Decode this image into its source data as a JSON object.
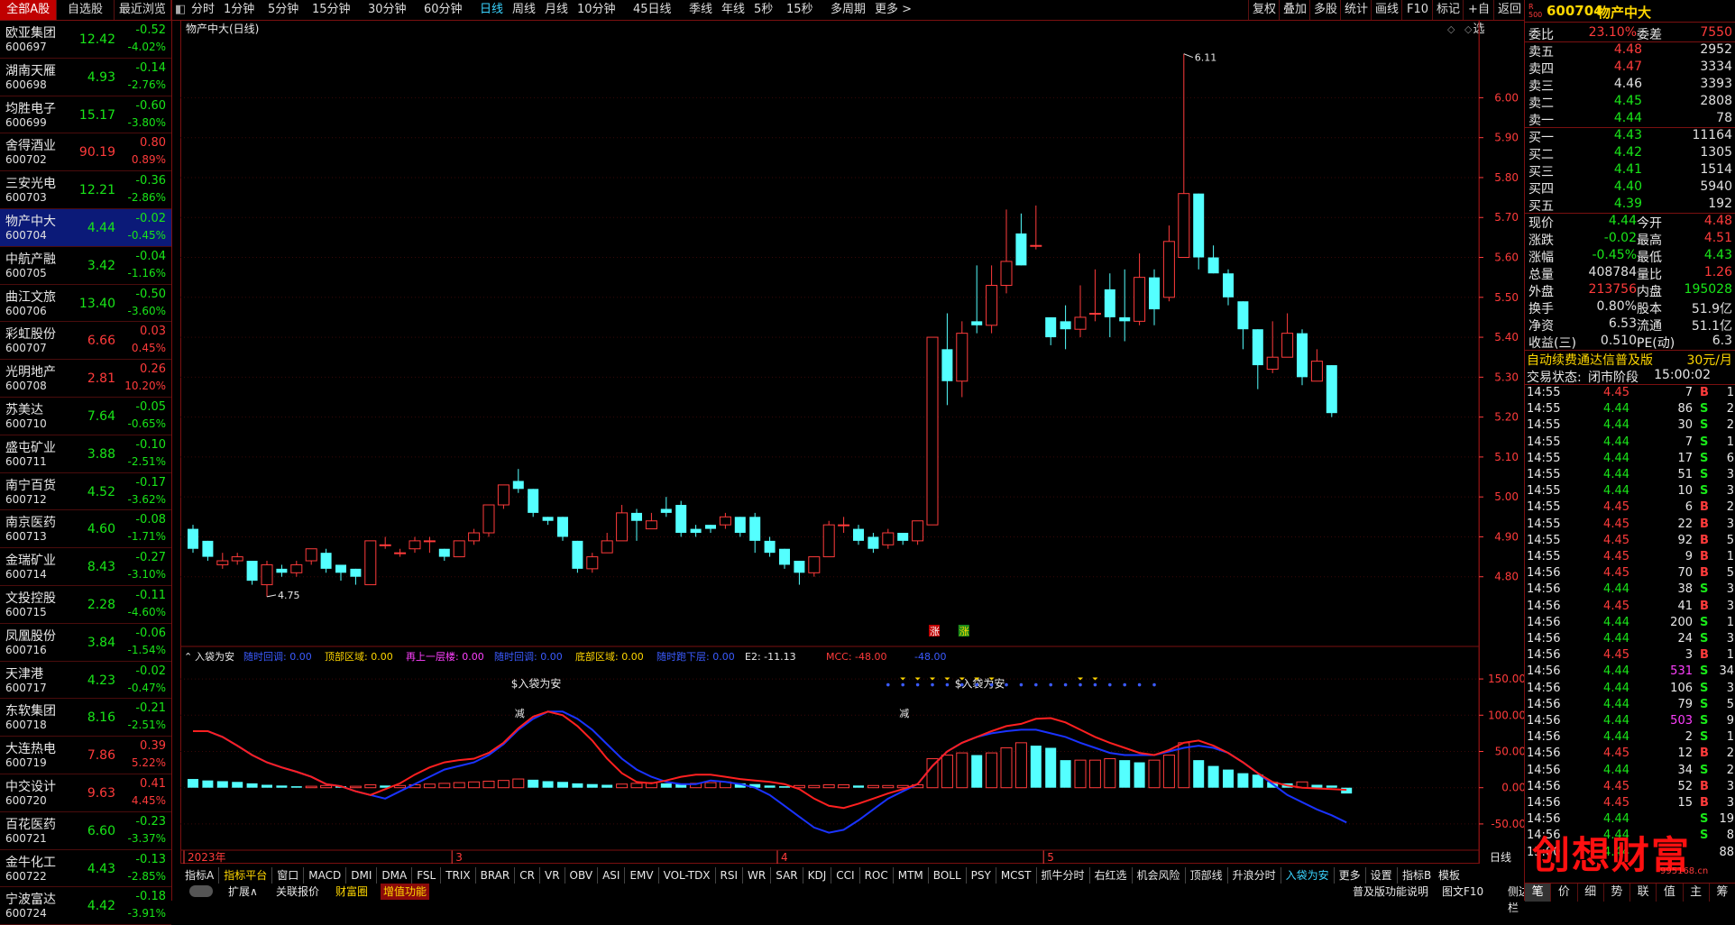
{
  "left_tabs": [
    "全部A股",
    "自选股",
    "最近浏览"
  ],
  "stocks": [
    {
      "name": "欧亚集团",
      "code": "600697",
      "price": "12.42",
      "chg": "-0.52",
      "pct": "-4.02%",
      "dir": "dn"
    },
    {
      "name": "湖南天雁",
      "code": "600698",
      "price": "4.93",
      "chg": "-0.14",
      "pct": "-2.76%",
      "dir": "dn"
    },
    {
      "name": "均胜电子",
      "code": "600699",
      "price": "15.17",
      "chg": "-0.60",
      "pct": "-3.80%",
      "dir": "dn"
    },
    {
      "name": "舍得酒业",
      "code": "600702",
      "price": "90.19",
      "chg": "0.80",
      "pct": "0.89%",
      "dir": "up"
    },
    {
      "name": "三安光电",
      "code": "600703",
      "price": "12.21",
      "chg": "-0.36",
      "pct": "-2.86%",
      "dir": "dn"
    },
    {
      "name": "物产中大",
      "code": "600704",
      "price": "4.44",
      "chg": "-0.02",
      "pct": "-0.45%",
      "dir": "dn",
      "selected": true
    },
    {
      "name": "中航产融",
      "code": "600705",
      "price": "3.42",
      "chg": "-0.04",
      "pct": "-1.16%",
      "dir": "dn"
    },
    {
      "name": "曲江文旅",
      "code": "600706",
      "price": "13.40",
      "chg": "-0.50",
      "pct": "-3.60%",
      "dir": "dn"
    },
    {
      "name": "彩虹股份",
      "code": "600707",
      "price": "6.66",
      "chg": "0.03",
      "pct": "0.45%",
      "dir": "up"
    },
    {
      "name": "光明地产",
      "code": "600708",
      "price": "2.81",
      "chg": "0.26",
      "pct": "10.20%",
      "dir": "up"
    },
    {
      "name": "苏美达",
      "code": "600710",
      "price": "7.64",
      "chg": "-0.05",
      "pct": "-0.65%",
      "dir": "dn"
    },
    {
      "name": "盛屯矿业",
      "code": "600711",
      "price": "3.88",
      "chg": "-0.10",
      "pct": "-2.51%",
      "dir": "dn"
    },
    {
      "name": "南宁百货",
      "code": "600712",
      "price": "4.52",
      "chg": "-0.17",
      "pct": "-3.62%",
      "dir": "dn"
    },
    {
      "name": "南京医药",
      "code": "600713",
      "price": "4.60",
      "chg": "-0.08",
      "pct": "-1.71%",
      "dir": "dn"
    },
    {
      "name": "金瑞矿业",
      "code": "600714",
      "price": "8.43",
      "chg": "-0.27",
      "pct": "-3.10%",
      "dir": "dn"
    },
    {
      "name": "文投控股",
      "code": "600715",
      "price": "2.28",
      "chg": "-0.11",
      "pct": "-4.60%",
      "dir": "dn"
    },
    {
      "name": "凤凰股份",
      "code": "600716",
      "price": "3.84",
      "chg": "-0.06",
      "pct": "-1.54%",
      "dir": "dn"
    },
    {
      "name": "天津港",
      "code": "600717",
      "price": "4.23",
      "chg": "-0.02",
      "pct": "-0.47%",
      "dir": "dn"
    },
    {
      "name": "东软集团",
      "code": "600718",
      "price": "8.16",
      "chg": "-0.21",
      "pct": "-2.51%",
      "dir": "dn"
    },
    {
      "name": "大连热电",
      "code": "600719",
      "price": "7.86",
      "chg": "0.39",
      "pct": "5.22%",
      "dir": "up"
    },
    {
      "name": "中交设计",
      "code": "600720",
      "price": "9.63",
      "chg": "0.41",
      "pct": "4.45%",
      "dir": "up"
    },
    {
      "name": "百花医药",
      "code": "600721",
      "price": "6.60",
      "chg": "-0.23",
      "pct": "-3.37%",
      "dir": "dn"
    },
    {
      "name": "金牛化工",
      "code": "600722",
      "price": "4.43",
      "chg": "-0.13",
      "pct": "-2.85%",
      "dir": "dn"
    },
    {
      "name": "宁波富达",
      "code": "600724",
      "price": "4.42",
      "chg": "-0.18",
      "pct": "-3.91%",
      "dir": "dn"
    }
  ],
  "toolbar": {
    "periods": [
      "分时",
      "1分钟",
      "5分钟",
      "15分钟",
      "30分钟",
      "60分钟",
      "日线",
      "周线",
      "月线",
      "10分钟",
      "45日线",
      "季线",
      "年线",
      "5秒",
      "15秒",
      "多周期",
      "更多 >"
    ],
    "active_period": "日线",
    "right_buttons": [
      "复权",
      "叠加",
      "多股",
      "统计",
      "画线",
      "F10",
      "标记",
      "+自选",
      "返回"
    ]
  },
  "chart_title": "物产中大(日线)",
  "chart_data": {
    "type": "candlestick",
    "y_ticks": [
      "6.00",
      "5.90",
      "5.80",
      "5.70",
      "5.60",
      "5.50",
      "5.40",
      "5.30",
      "5.20",
      "5.10",
      "5.00",
      "4.90",
      "4.80"
    ],
    "ylim": [
      4.75,
      6.11
    ],
    "high_label": "6.11",
    "low_label": "4.75",
    "x_labels": [
      "2023年",
      "3",
      "4",
      "5"
    ],
    "candles": [
      [
        4.92,
        4.87,
        4.93,
        4.86
      ],
      [
        4.89,
        4.85,
        4.89,
        4.84
      ],
      [
        4.83,
        4.84,
        4.86,
        4.82
      ],
      [
        4.84,
        4.85,
        4.86,
        4.83
      ],
      [
        4.84,
        4.79,
        4.84,
        4.78
      ],
      [
        4.78,
        4.83,
        4.84,
        4.75
      ],
      [
        4.82,
        4.81,
        4.83,
        4.8
      ],
      [
        4.81,
        4.83,
        4.84,
        4.8
      ],
      [
        4.84,
        4.87,
        4.87,
        4.83
      ],
      [
        4.86,
        4.82,
        4.87,
        4.81
      ],
      [
        4.83,
        4.81,
        4.83,
        4.79
      ],
      [
        4.82,
        4.8,
        4.82,
        4.78
      ],
      [
        4.78,
        4.89,
        4.89,
        4.78
      ],
      [
        4.88,
        4.88,
        4.9,
        4.87
      ],
      [
        4.86,
        4.86,
        4.87,
        4.85
      ],
      [
        4.87,
        4.89,
        4.9,
        4.86
      ],
      [
        4.89,
        4.89,
        4.9,
        4.86
      ],
      [
        4.87,
        4.85,
        4.87,
        4.84
      ],
      [
        4.85,
        4.89,
        4.89,
        4.85
      ],
      [
        4.89,
        4.91,
        4.92,
        4.88
      ],
      [
        4.91,
        4.98,
        4.98,
        4.9
      ],
      [
        4.98,
        5.03,
        5.03,
        4.97
      ],
      [
        5.04,
        5.02,
        5.07,
        5.01
      ],
      [
        5.02,
        4.96,
        5.02,
        4.95
      ],
      [
        4.95,
        4.94,
        4.95,
        4.93
      ],
      [
        4.95,
        4.9,
        4.95,
        4.89
      ],
      [
        4.89,
        4.82,
        4.89,
        4.81
      ],
      [
        4.82,
        4.85,
        4.86,
        4.81
      ],
      [
        4.86,
        4.89,
        4.91,
        4.86
      ],
      [
        4.89,
        4.96,
        4.98,
        4.89
      ],
      [
        4.96,
        4.94,
        4.97,
        4.89
      ],
      [
        4.92,
        4.94,
        4.96,
        4.92
      ],
      [
        4.97,
        4.96,
        5.0,
        4.95
      ],
      [
        4.98,
        4.91,
        4.99,
        4.9
      ],
      [
        4.92,
        4.91,
        4.93,
        4.9
      ],
      [
        4.93,
        4.92,
        4.93,
        4.91
      ],
      [
        4.93,
        4.95,
        4.96,
        4.92
      ],
      [
        4.95,
        4.91,
        4.95,
        4.9
      ],
      [
        4.95,
        4.89,
        4.96,
        4.86
      ],
      [
        4.89,
        4.86,
        4.9,
        4.85
      ],
      [
        4.87,
        4.83,
        4.87,
        4.82
      ],
      [
        4.84,
        4.81,
        4.84,
        4.78
      ],
      [
        4.81,
        4.85,
        4.85,
        4.8
      ],
      [
        4.85,
        4.93,
        4.94,
        4.85
      ],
      [
        4.93,
        4.93,
        4.95,
        4.91
      ],
      [
        4.92,
        4.89,
        4.93,
        4.88
      ],
      [
        4.9,
        4.87,
        4.91,
        4.86
      ],
      [
        4.88,
        4.91,
        4.92,
        4.87
      ],
      [
        4.91,
        4.89,
        4.91,
        4.88
      ],
      [
        4.89,
        4.94,
        4.94,
        4.88
      ],
      [
        4.93,
        5.4,
        5.4,
        4.93
      ],
      [
        5.37,
        5.29,
        5.46,
        5.23
      ],
      [
        5.29,
        5.41,
        5.44,
        5.25
      ],
      [
        5.44,
        5.43,
        5.58,
        5.41
      ],
      [
        5.43,
        5.53,
        5.58,
        5.41
      ],
      [
        5.53,
        5.59,
        5.72,
        5.51
      ],
      [
        5.66,
        5.58,
        5.71,
        5.58
      ],
      [
        5.63,
        5.63,
        5.73,
        5.62
      ],
      [
        5.45,
        5.4,
        5.45,
        5.38
      ],
      [
        5.44,
        5.42,
        5.48,
        5.37
      ],
      [
        5.42,
        5.45,
        5.53,
        5.4
      ],
      [
        5.46,
        5.46,
        5.57,
        5.44
      ],
      [
        5.52,
        5.45,
        5.56,
        5.4
      ],
      [
        5.45,
        5.44,
        5.57,
        5.39
      ],
      [
        5.44,
        5.55,
        5.61,
        5.43
      ],
      [
        5.55,
        5.47,
        5.57,
        5.43
      ],
      [
        5.5,
        5.64,
        5.68,
        5.49
      ],
      [
        5.6,
        5.76,
        6.11,
        5.6
      ],
      [
        5.76,
        5.6,
        5.76,
        5.57
      ],
      [
        5.6,
        5.56,
        5.63,
        5.56
      ],
      [
        5.56,
        5.5,
        5.57,
        5.48
      ],
      [
        5.49,
        5.42,
        5.49,
        5.37
      ],
      [
        5.42,
        5.33,
        5.42,
        5.27
      ],
      [
        5.32,
        5.35,
        5.44,
        5.31
      ],
      [
        5.35,
        5.41,
        5.46,
        5.36
      ],
      [
        5.41,
        5.3,
        5.42,
        5.28
      ],
      [
        5.29,
        5.34,
        5.37,
        5.32
      ],
      [
        5.33,
        5.21,
        5.33,
        5.2
      ]
    ],
    "limit_up_markers": [
      "涨",
      "涨"
    ],
    "indicator": {
      "name": "入袋为安",
      "legend": [
        {
          "text": "随时回调: 0.00",
          "color": "#3b5bff"
        },
        {
          "text": "顶部区域: 0.00",
          "color": "#ffd700"
        },
        {
          "text": "再上一层楼: 0.00",
          "color": "#ff40ff"
        },
        {
          "text": "随时回调: 0.00",
          "color": "#3b5bff"
        },
        {
          "text": "底部区域: 0.00",
          "color": "#ffd700"
        },
        {
          "text": "随时跑下层: 0.00",
          "color": "#3b5bff"
        },
        {
          "text": "E2: -11.13",
          "color": "#e8e8e8"
        },
        {
          "text": "MCC: -48.00",
          "color": "#ff3b3b"
        },
        {
          "text": "-48.00",
          "color": "#3b5bff"
        }
      ],
      "y_ticks": [
        "150.00",
        "100.00",
        "50.00",
        "0.00",
        "-50.00"
      ],
      "ylim": [
        -70,
        170
      ],
      "annotations": [
        "$入袋为安",
        "$入袋为安",
        "减",
        "减"
      ],
      "bars": [
        12,
        10,
        9,
        8,
        6,
        4,
        3,
        2,
        2,
        3,
        2,
        2,
        4,
        3,
        3,
        4,
        5,
        6,
        7,
        8,
        9,
        10,
        12,
        11,
        9,
        8,
        6,
        5,
        4,
        5,
        6,
        7,
        6,
        5,
        6,
        7,
        8,
        6,
        5,
        3,
        2,
        3,
        3,
        4,
        4,
        3,
        3,
        3,
        3,
        4,
        40,
        45,
        48,
        45,
        48,
        55,
        62,
        58,
        55,
        38,
        38,
        38,
        40,
        38,
        35,
        38,
        45,
        62,
        38,
        30,
        25,
        20,
        18,
        8,
        6,
        8,
        4,
        3,
        -8
      ],
      "red_line": [
        78,
        78,
        70,
        58,
        45,
        35,
        28,
        22,
        15,
        5,
        2,
        -5,
        -10,
        -2,
        6,
        18,
        28,
        35,
        38,
        40,
        48,
        62,
        82,
        98,
        105,
        100,
        85,
        65,
        40,
        20,
        8,
        6,
        10,
        15,
        18,
        18,
        15,
        12,
        10,
        8,
        5,
        -2,
        -15,
        -25,
        -28,
        -22,
        -15,
        -8,
        -2,
        5,
        30,
        50,
        62,
        70,
        78,
        85,
        88,
        95,
        96,
        90,
        80,
        70,
        62,
        55,
        48,
        45,
        52,
        62,
        65,
        58,
        48,
        35,
        20,
        8,
        3,
        0,
        -1,
        -2,
        -3
      ],
      "blue_line": [
        78,
        78,
        70,
        58,
        45,
        35,
        28,
        22,
        15,
        5,
        2,
        -5,
        -10,
        -15,
        -5,
        5,
        15,
        25,
        30,
        35,
        45,
        60,
        80,
        95,
        105,
        105,
        95,
        80,
        60,
        40,
        25,
        15,
        8,
        5,
        5,
        10,
        8,
        5,
        0,
        -10,
        -25,
        -40,
        -55,
        -62,
        -58,
        -45,
        -30,
        -15,
        -5,
        5,
        30,
        50,
        62,
        70,
        75,
        78,
        80,
        80,
        75,
        70,
        62,
        55,
        48,
        45,
        45,
        45,
        50,
        55,
        58,
        55,
        48,
        35,
        20,
        5,
        -10,
        -20,
        -30,
        -38,
        -48
      ]
    }
  },
  "bottom_tabs": [
    "指标A",
    "指标平台",
    "窗口",
    "MACD",
    "DMI",
    "DMA",
    "FSL",
    "TRIX",
    "BRAR",
    "CR",
    "VR",
    "OBV",
    "ASI",
    "EMV",
    "VOL-TDX",
    "RSI",
    "WR",
    "SAR",
    "KDJ",
    "CCI",
    "ROC",
    "MTM",
    "BOLL",
    "PSY",
    "MCST",
    "抓牛分时",
    "右红选",
    "机会风险",
    "顶部线",
    "升浪分时",
    "入袋为安",
    "更多",
    "设置"
  ],
  "bottom_tabs_right": [
    "指标B",
    "模板"
  ],
  "bottom_row2": [
    "扩展∧",
    "关联报价",
    "财富圈",
    "增值功能"
  ],
  "bottom_row2_right": [
    "普及版功能说明",
    "图文F10",
    "侧边栏"
  ],
  "time_axis_btn": "日线",
  "quote": {
    "code": "600704",
    "name": "物产中大",
    "weibi_label": "委比",
    "weibi": "23.10%",
    "weicha_label": "委差",
    "weicha": "7550",
    "asks": [
      {
        "label": "卖五",
        "price": "4.48",
        "vol": "2952",
        "dir": "up"
      },
      {
        "label": "卖四",
        "price": "4.47",
        "vol": "3334",
        "dir": "up"
      },
      {
        "label": "卖三",
        "price": "4.46",
        "vol": "3393",
        "dir": "wh"
      },
      {
        "label": "卖二",
        "price": "4.45",
        "vol": "2808",
        "dir": "dn"
      },
      {
        "label": "卖一",
        "price": "4.44",
        "vol": "78",
        "dir": "dn"
      }
    ],
    "bids": [
      {
        "label": "买一",
        "price": "4.43",
        "vol": "11164",
        "dir": "dn"
      },
      {
        "label": "买二",
        "price": "4.42",
        "vol": "1305",
        "dir": "dn"
      },
      {
        "label": "买三",
        "price": "4.41",
        "vol": "1514",
        "dir": "dn"
      },
      {
        "label": "买四",
        "price": "4.40",
        "vol": "5940",
        "dir": "dn"
      },
      {
        "label": "买五",
        "price": "4.39",
        "vol": "192",
        "dir": "dn"
      }
    ],
    "stats": [
      {
        "k1": "现价",
        "v1": "4.44",
        "c1": "dn",
        "k2": "今开",
        "v2": "4.48",
        "c2": "up"
      },
      {
        "k1": "涨跌",
        "v1": "-0.02",
        "c1": "dn",
        "k2": "最高",
        "v2": "4.51",
        "c2": "up"
      },
      {
        "k1": "涨幅",
        "v1": "-0.45%",
        "c1": "dn",
        "k2": "最低",
        "v2": "4.43",
        "c2": "dn"
      },
      {
        "k1": "总量",
        "v1": "408784",
        "c1": "wh",
        "k2": "量比",
        "v2": "1.26",
        "c2": "up"
      },
      {
        "k1": "外盘",
        "v1": "213756",
        "c1": "up",
        "k2": "内盘",
        "v2": "195028",
        "c2": "dn"
      },
      {
        "k1": "换手",
        "v1": "0.80%",
        "c1": "wh",
        "k2": "股本",
        "v2": "51.9亿",
        "c2": "wh"
      },
      {
        "k1": "净资",
        "v1": "6.53",
        "c1": "wh",
        "k2": "流通",
        "v2": "51.1亿",
        "c2": "wh"
      },
      {
        "k1": "收益(三)",
        "v1": "0.510",
        "c1": "wh",
        "k2": "PE(动)",
        "v2": "6.3",
        "c2": "wh"
      }
    ],
    "promo": "自动续费通达信普及版",
    "promo_price": "30元/月",
    "status_label": "交易状态:",
    "status_value": "闭市阶段",
    "status_time": "15:00:02"
  },
  "ticks": [
    [
      "14:55",
      "4.45",
      "7",
      "B",
      "1"
    ],
    [
      "14:55",
      "4.44",
      "86",
      "S",
      "2"
    ],
    [
      "14:55",
      "4.44",
      "30",
      "S",
      "2"
    ],
    [
      "14:55",
      "4.44",
      "7",
      "S",
      "1"
    ],
    [
      "14:55",
      "4.44",
      "17",
      "S",
      "6"
    ],
    [
      "14:55",
      "4.44",
      "51",
      "S",
      "3"
    ],
    [
      "14:55",
      "4.44",
      "10",
      "S",
      "3"
    ],
    [
      "14:55",
      "4.45",
      "6",
      "B",
      "2"
    ],
    [
      "14:55",
      "4.45",
      "22",
      "B",
      "3"
    ],
    [
      "14:55",
      "4.45",
      "92",
      "B",
      "5"
    ],
    [
      "14:55",
      "4.45",
      "9",
      "B",
      "1"
    ],
    [
      "14:56",
      "4.45",
      "70",
      "B",
      "5"
    ],
    [
      "14:56",
      "4.44",
      "38",
      "S",
      "3"
    ],
    [
      "14:56",
      "4.45",
      "41",
      "B",
      "3"
    ],
    [
      "14:56",
      "4.44",
      "200",
      "S",
      "1"
    ],
    [
      "14:56",
      "4.44",
      "24",
      "S",
      "3"
    ],
    [
      "14:56",
      "4.45",
      "3",
      "B",
      "1"
    ],
    [
      "14:56",
      "4.44",
      "531",
      "S",
      "34"
    ],
    [
      "14:56",
      "4.44",
      "106",
      "S",
      "3"
    ],
    [
      "14:56",
      "4.44",
      "79",
      "S",
      "5"
    ],
    [
      "14:56",
      "4.44",
      "503",
      "S",
      "9"
    ],
    [
      "14:56",
      "4.44",
      "2",
      "S",
      "1"
    ],
    [
      "14:56",
      "4.45",
      "12",
      "B",
      "2"
    ],
    [
      "14:56",
      "4.44",
      "34",
      "S",
      "2"
    ],
    [
      "14:56",
      "4.45",
      "52",
      "B",
      "3"
    ],
    [
      "14:56",
      "4.45",
      "15",
      "B",
      "3"
    ],
    [
      "14:56",
      "4.44",
      "",
      "S",
      "19"
    ],
    [
      "14:56",
      "4.44",
      "",
      "S",
      "8"
    ],
    [
      "15:00",
      "4.44",
      "",
      "",
      "88"
    ]
  ],
  "watermark": "创想财富",
  "watermark_url": "995168.cn",
  "right_bottom_tabs": [
    "笔",
    "价",
    "细",
    "势",
    "联",
    "值",
    "主",
    "筹"
  ]
}
